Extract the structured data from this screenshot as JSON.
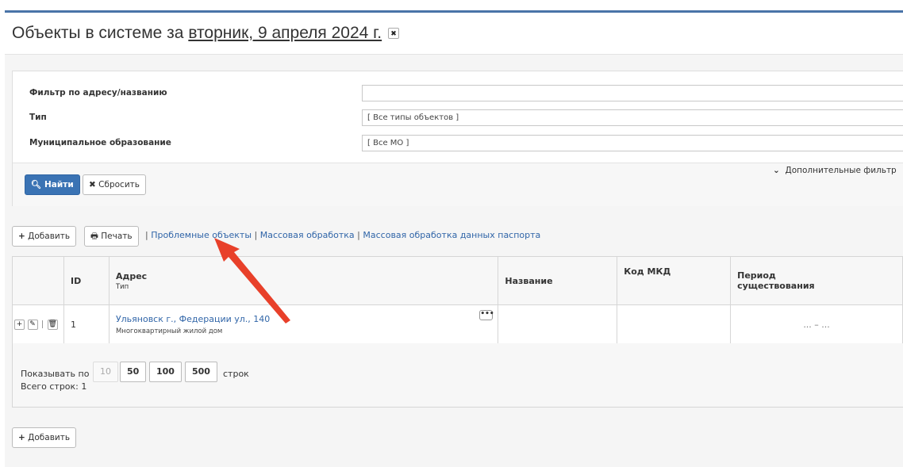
{
  "header": {
    "title_prefix": "Объекты в системе за",
    "date_link": "вторник, 9 апреля 2024 г.",
    "clear_icon": "close-icon"
  },
  "filters": {
    "address_label": "Фильтр по адресу/названию",
    "address_value": "",
    "type_label": "Тип",
    "type_value": "[ Все типы объектов ]",
    "mo_label": "Муниципальное образование",
    "mo_value": "[ Все МО ]",
    "find_button": "Найти",
    "reset_button": "Сбросить",
    "more_filters": "Дополнительные фильтр"
  },
  "toolbar": {
    "add_button": "Добавить",
    "print_button": "Печать",
    "links": [
      "Проблемные объекты",
      "Массовая обработка",
      "Массовая обработка данных паспорта"
    ],
    "separator": "|"
  },
  "table": {
    "headers": {
      "id": "ID",
      "address": "Адрес",
      "address_sub": "Тип",
      "name": "Название",
      "mkd": "Код МКД",
      "period_line1": "Период",
      "period_line2": "существования"
    },
    "rows": [
      {
        "id": "1",
        "address": "Ульяновск г., Федерации ул., 140",
        "type": "Многоквартирный жилой дом",
        "name": "",
        "mkd": "",
        "period": "... – ..."
      }
    ]
  },
  "pager": {
    "show_label": "Показывать по",
    "sizes": [
      "10",
      "50",
      "100",
      "500"
    ],
    "active_size": "10",
    "rows_label": "строк",
    "total_label": "Всего строк: 1"
  },
  "bottom": {
    "add_button": "Добавить"
  },
  "colors": {
    "accent": "#3a73b4",
    "link": "#3065a8",
    "annotation_arrow": "#e8402a"
  }
}
